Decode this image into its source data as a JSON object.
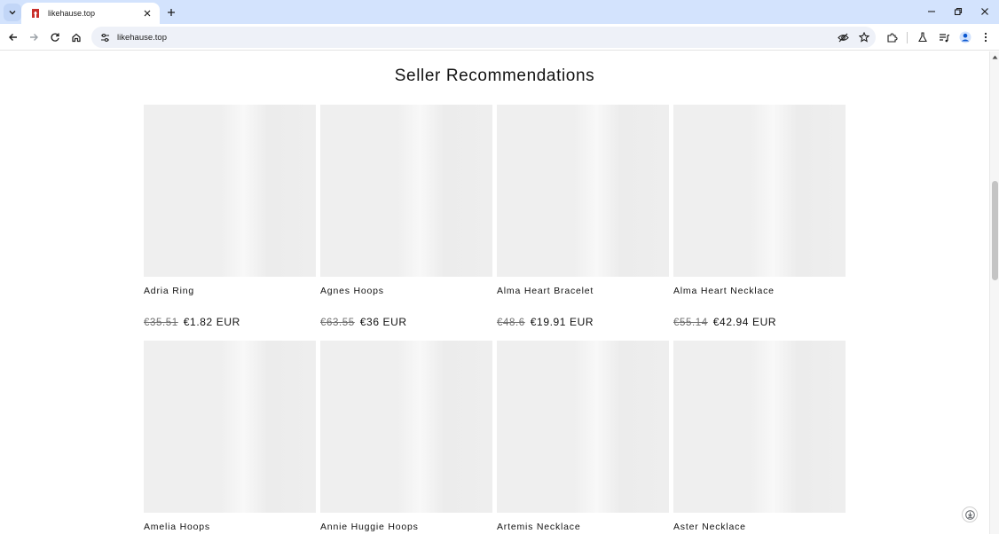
{
  "browser": {
    "tab_title": "likehause.top",
    "url": "likehause.top",
    "accent": "#d3e3fd",
    "icons": {
      "tab_search": "chevron-down-icon",
      "favicon": "likehause-favicon",
      "tab_close": "close-icon",
      "new_tab": "plus-icon",
      "minimize": "minimize-icon",
      "restore": "restore-icon",
      "close_window": "close-icon",
      "back": "arrow-left-icon",
      "forward": "arrow-right-icon",
      "reload": "reload-icon",
      "home": "home-icon",
      "site_info": "tune-icon",
      "eye_off": "eye-off-icon",
      "bookmark": "star-icon",
      "extensions": "puzzle-icon",
      "labs": "flask-icon",
      "media": "playlist-icon",
      "profile": "avatar-icon",
      "menu": "kebab-icon"
    }
  },
  "page": {
    "section_title": "Seller Recommendations",
    "products": [
      {
        "name": "Adria Ring",
        "old_price": "€35.51",
        "price": "€1.82 EUR"
      },
      {
        "name": "Agnes Hoops",
        "old_price": "€63.55",
        "price": "€36 EUR"
      },
      {
        "name": "Alma Heart Bracelet",
        "old_price": "€48.6",
        "price": "€19.91 EUR"
      },
      {
        "name": "Alma Heart Necklace",
        "old_price": "€55.14",
        "price": "€42.94 EUR"
      },
      {
        "name": "Amelia Hoops",
        "old_price": "",
        "price": ""
      },
      {
        "name": "Annie Huggie Hoops",
        "old_price": "",
        "price": ""
      },
      {
        "name": "Artemis Necklace",
        "old_price": "",
        "price": ""
      },
      {
        "name": "Aster Necklace",
        "old_price": "",
        "price": ""
      }
    ]
  }
}
